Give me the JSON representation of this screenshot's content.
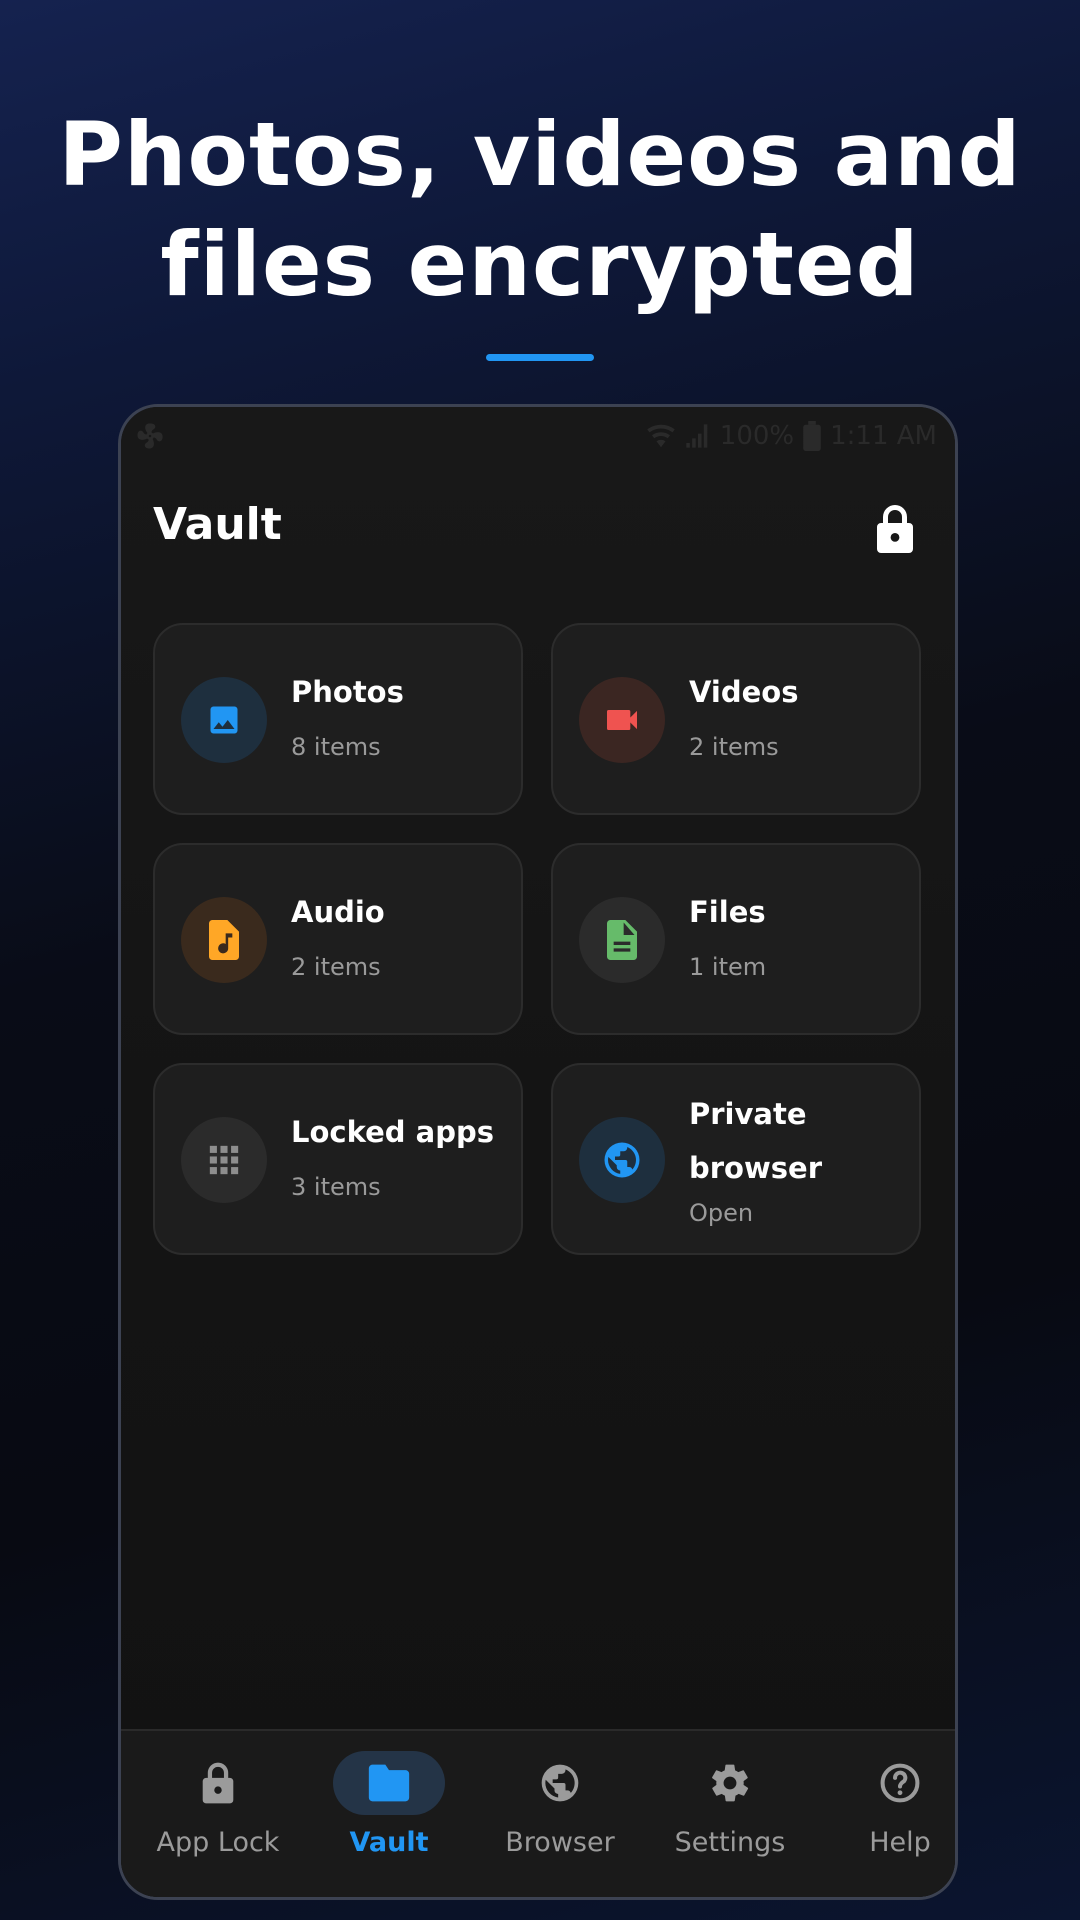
{
  "headline": {
    "line1": "Photos, videos and",
    "line2": "files encrypted"
  },
  "colors": {
    "accent": "#2196f3",
    "photos": "#2196f3",
    "videos": "#ef5350",
    "audio": "#ffa726",
    "files": "#66bb6a",
    "locked_apps": "#8e8e8e",
    "browser": "#2196f3"
  },
  "status_bar": {
    "battery": "100%",
    "time": "1:11 AM"
  },
  "app": {
    "title": "Vault"
  },
  "cards": [
    {
      "title": "Photos",
      "subtitle": "8 items",
      "icon": "image-icon"
    },
    {
      "title": "Videos",
      "subtitle": "2 items",
      "icon": "videocam-icon"
    },
    {
      "title": "Audio",
      "subtitle": "2 items",
      "icon": "audio-file-icon"
    },
    {
      "title": "Files",
      "subtitle": "1 item",
      "icon": "document-icon"
    },
    {
      "title": "Locked apps",
      "subtitle": "3 items",
      "icon": "apps-grid-icon"
    },
    {
      "title": "Private browser",
      "subtitle": "Open",
      "icon": "globe-icon"
    }
  ],
  "bottom_nav": [
    {
      "label": "App Lock",
      "icon": "lock-icon",
      "active": false
    },
    {
      "label": "Vault",
      "icon": "folder-icon",
      "active": true
    },
    {
      "label": "Browser",
      "icon": "globe-icon",
      "active": false
    },
    {
      "label": "Settings",
      "icon": "gear-icon",
      "active": false
    },
    {
      "label": "Help",
      "icon": "help-icon",
      "active": false
    }
  ]
}
